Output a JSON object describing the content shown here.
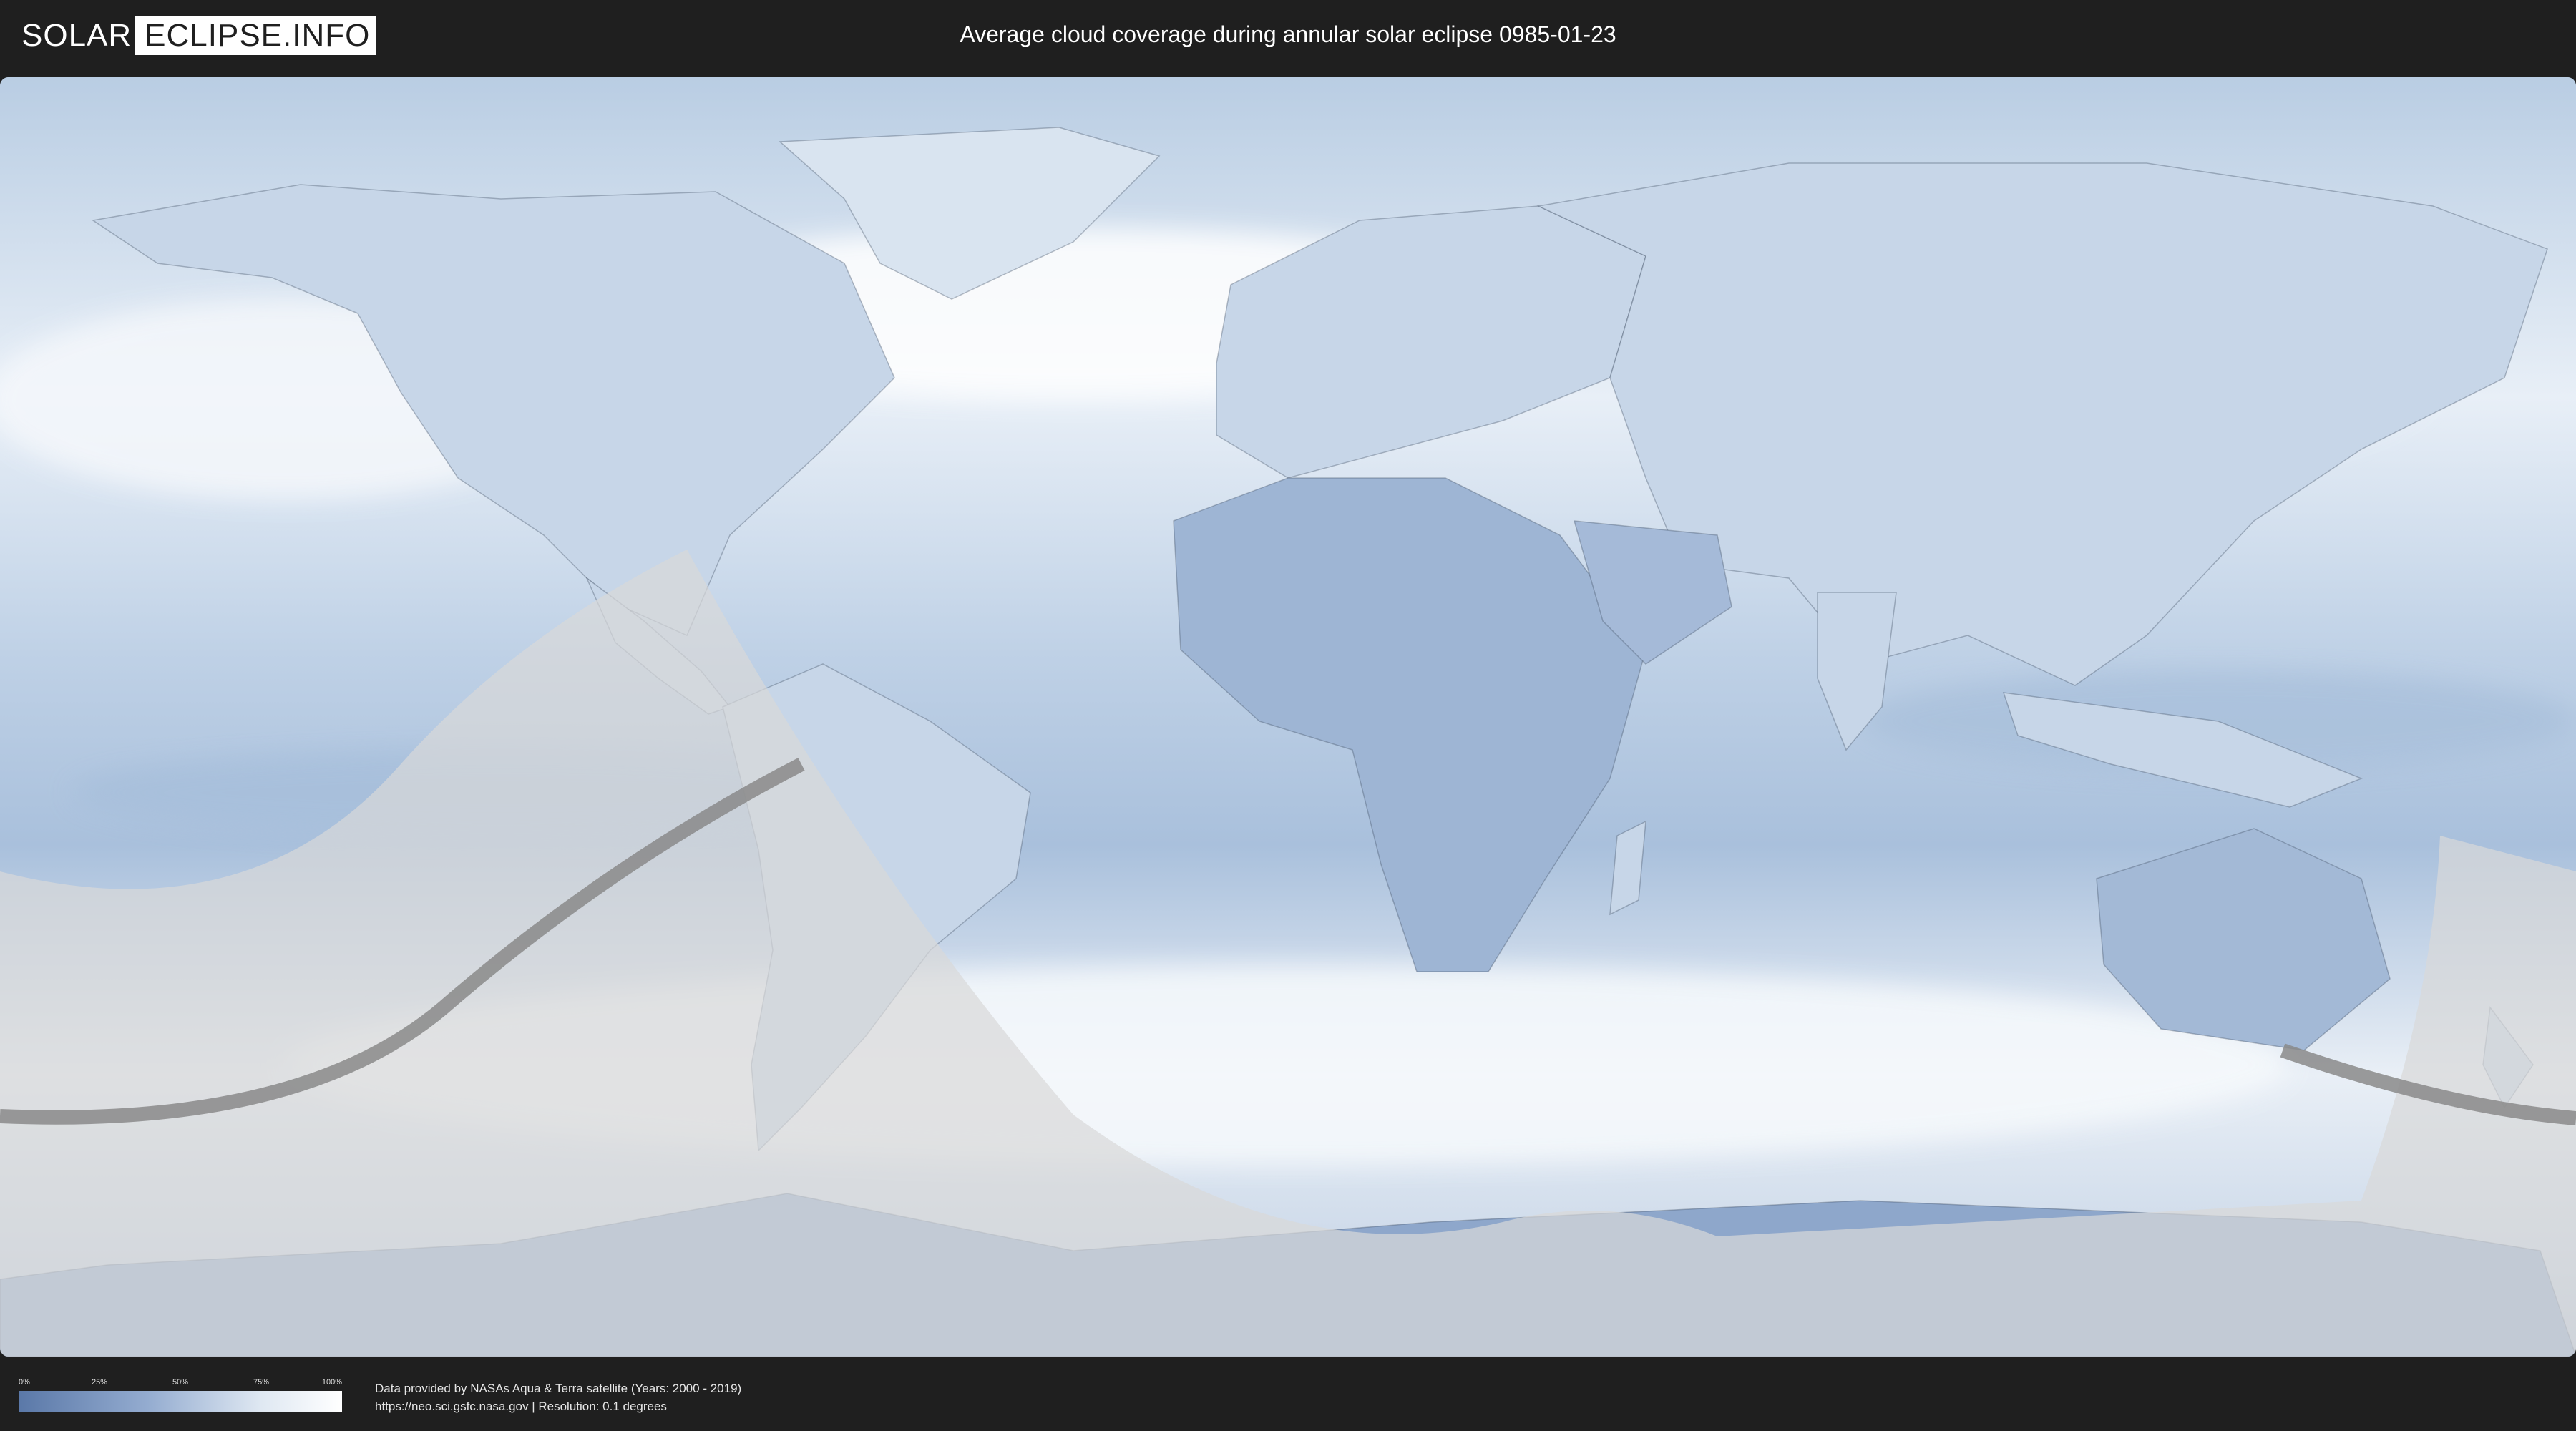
{
  "header": {
    "logo_left": "SOLAR",
    "logo_right": "ECLIPSE.INFO",
    "title": "Average cloud coverage during annular solar eclipse 0985-01-23"
  },
  "map": {
    "colors": {
      "cloud_high": "#ffffff",
      "cloud_low": "#5a78a8",
      "shadow_zone": "#d9d9d9",
      "central_path": "#8a8a8a",
      "borders": "#3b4a5e"
    }
  },
  "legend": {
    "ticks": [
      "0%",
      "25%",
      "50%",
      "75%",
      "100%"
    ]
  },
  "credits": {
    "line1": "Data provided by NASAs Aqua & Terra satellite (Years: 2000 - 2019)",
    "line2": "https://neo.sci.gsfc.nasa.gov | Resolution: 0.1 degrees"
  }
}
